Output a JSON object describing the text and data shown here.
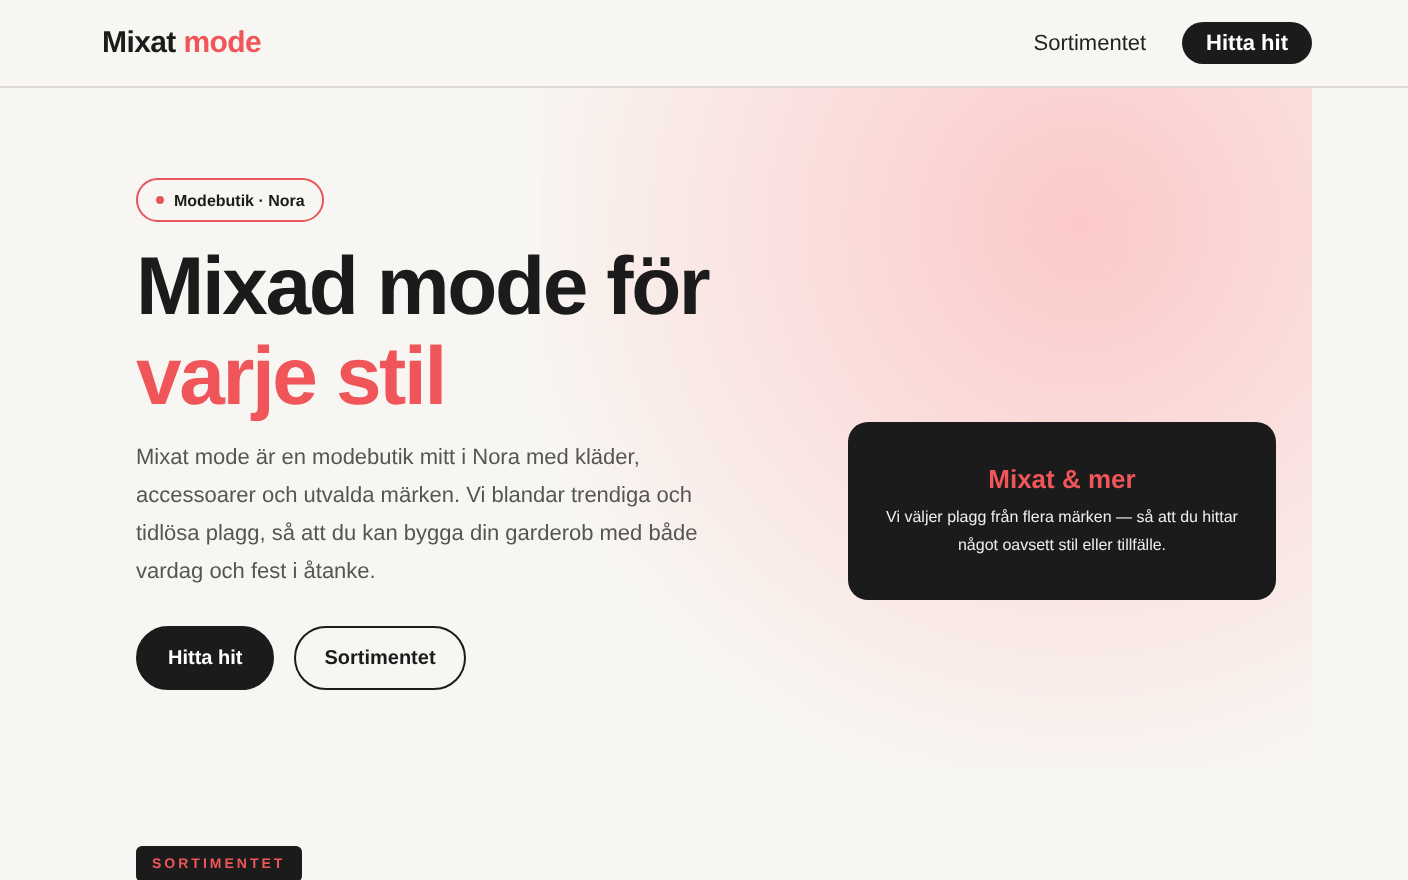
{
  "header": {
    "logo": {
      "first": "Mixat",
      "second": "mode"
    },
    "nav": [
      {
        "label": "Sortimentet",
        "kind": "link"
      },
      {
        "label": "Hitta hit",
        "kind": "button"
      }
    ]
  },
  "hero": {
    "badge": "Modebutik · Nora",
    "title_lines": [
      {
        "text": "Mixad mode för",
        "accent": false
      },
      {
        "text": "varje stil",
        "accent": true
      }
    ],
    "intro": "Mixat mode är en modebutik mitt i Nora med kläder, accessoarer och utvalda märken. Vi blandar trendiga och tidlösa plagg, så att du kan bygga din garderob med både vardag och fest i åtanke.",
    "buttons": [
      {
        "label": "Hitta hit",
        "kind": "primary"
      },
      {
        "label": "Sortimentet",
        "kind": "outline"
      }
    ],
    "card": {
      "title": "Mixat & mer",
      "text": "Vi väljer plagg från flera märken — så att du hittar något oavsett stil eller tillfälle."
    }
  },
  "section": {
    "tag": "SORTIMENTET"
  }
}
